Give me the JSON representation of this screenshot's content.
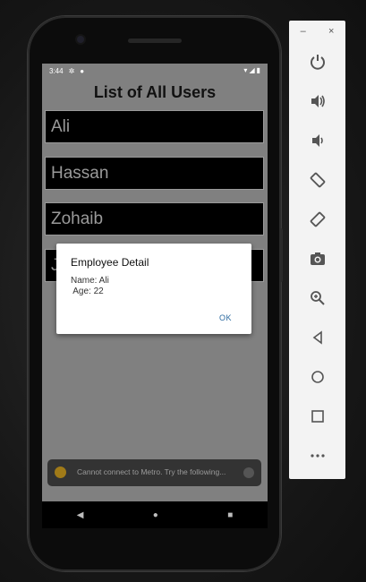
{
  "status_bar": {
    "time": "3:44"
  },
  "screen": {
    "title": "List of All Users"
  },
  "users": [
    "Ali",
    "Hassan",
    "Zohaib",
    "J"
  ],
  "dialog": {
    "title": "Employee Detail",
    "name_line": "Name: Ali",
    "age_line": " Age: 22",
    "ok_label": "OK"
  },
  "toast": {
    "message": "Cannot connect to Metro.  Try the following..."
  },
  "emulator_panel": {
    "minimize": "–",
    "close": "×",
    "buttons": [
      "power-icon",
      "volume-up-icon",
      "volume-down-icon",
      "rotate-left-icon",
      "rotate-right-icon",
      "camera-icon",
      "zoom-icon",
      "back-icon",
      "home-icon",
      "overview-icon",
      "more-icon"
    ]
  },
  "colors": {
    "screen_bg": "#808080",
    "row_bg": "#000000",
    "accent": "#2c6aa0"
  }
}
